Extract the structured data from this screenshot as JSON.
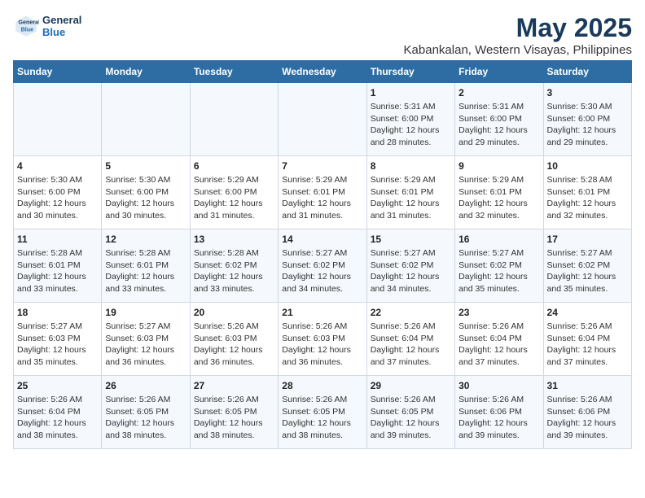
{
  "logo": {
    "line1": "General",
    "line2": "Blue"
  },
  "title": "May 2025",
  "subtitle": "Kabankalan, Western Visayas, Philippines",
  "headers": [
    "Sunday",
    "Monday",
    "Tuesday",
    "Wednesday",
    "Thursday",
    "Friday",
    "Saturday"
  ],
  "weeks": [
    [
      {
        "day": "",
        "info": ""
      },
      {
        "day": "",
        "info": ""
      },
      {
        "day": "",
        "info": ""
      },
      {
        "day": "",
        "info": ""
      },
      {
        "day": "1",
        "info": "Sunrise: 5:31 AM\nSunset: 6:00 PM\nDaylight: 12 hours\nand 28 minutes."
      },
      {
        "day": "2",
        "info": "Sunrise: 5:31 AM\nSunset: 6:00 PM\nDaylight: 12 hours\nand 29 minutes."
      },
      {
        "day": "3",
        "info": "Sunrise: 5:30 AM\nSunset: 6:00 PM\nDaylight: 12 hours\nand 29 minutes."
      }
    ],
    [
      {
        "day": "4",
        "info": "Sunrise: 5:30 AM\nSunset: 6:00 PM\nDaylight: 12 hours\nand 30 minutes."
      },
      {
        "day": "5",
        "info": "Sunrise: 5:30 AM\nSunset: 6:00 PM\nDaylight: 12 hours\nand 30 minutes."
      },
      {
        "day": "6",
        "info": "Sunrise: 5:29 AM\nSunset: 6:00 PM\nDaylight: 12 hours\nand 31 minutes."
      },
      {
        "day": "7",
        "info": "Sunrise: 5:29 AM\nSunset: 6:01 PM\nDaylight: 12 hours\nand 31 minutes."
      },
      {
        "day": "8",
        "info": "Sunrise: 5:29 AM\nSunset: 6:01 PM\nDaylight: 12 hours\nand 31 minutes."
      },
      {
        "day": "9",
        "info": "Sunrise: 5:29 AM\nSunset: 6:01 PM\nDaylight: 12 hours\nand 32 minutes."
      },
      {
        "day": "10",
        "info": "Sunrise: 5:28 AM\nSunset: 6:01 PM\nDaylight: 12 hours\nand 32 minutes."
      }
    ],
    [
      {
        "day": "11",
        "info": "Sunrise: 5:28 AM\nSunset: 6:01 PM\nDaylight: 12 hours\nand 33 minutes."
      },
      {
        "day": "12",
        "info": "Sunrise: 5:28 AM\nSunset: 6:01 PM\nDaylight: 12 hours\nand 33 minutes."
      },
      {
        "day": "13",
        "info": "Sunrise: 5:28 AM\nSunset: 6:02 PM\nDaylight: 12 hours\nand 33 minutes."
      },
      {
        "day": "14",
        "info": "Sunrise: 5:27 AM\nSunset: 6:02 PM\nDaylight: 12 hours\nand 34 minutes."
      },
      {
        "day": "15",
        "info": "Sunrise: 5:27 AM\nSunset: 6:02 PM\nDaylight: 12 hours\nand 34 minutes."
      },
      {
        "day": "16",
        "info": "Sunrise: 5:27 AM\nSunset: 6:02 PM\nDaylight: 12 hours\nand 35 minutes."
      },
      {
        "day": "17",
        "info": "Sunrise: 5:27 AM\nSunset: 6:02 PM\nDaylight: 12 hours\nand 35 minutes."
      }
    ],
    [
      {
        "day": "18",
        "info": "Sunrise: 5:27 AM\nSunset: 6:03 PM\nDaylight: 12 hours\nand 35 minutes."
      },
      {
        "day": "19",
        "info": "Sunrise: 5:27 AM\nSunset: 6:03 PM\nDaylight: 12 hours\nand 36 minutes."
      },
      {
        "day": "20",
        "info": "Sunrise: 5:26 AM\nSunset: 6:03 PM\nDaylight: 12 hours\nand 36 minutes."
      },
      {
        "day": "21",
        "info": "Sunrise: 5:26 AM\nSunset: 6:03 PM\nDaylight: 12 hours\nand 36 minutes."
      },
      {
        "day": "22",
        "info": "Sunrise: 5:26 AM\nSunset: 6:04 PM\nDaylight: 12 hours\nand 37 minutes."
      },
      {
        "day": "23",
        "info": "Sunrise: 5:26 AM\nSunset: 6:04 PM\nDaylight: 12 hours\nand 37 minutes."
      },
      {
        "day": "24",
        "info": "Sunrise: 5:26 AM\nSunset: 6:04 PM\nDaylight: 12 hours\nand 37 minutes."
      }
    ],
    [
      {
        "day": "25",
        "info": "Sunrise: 5:26 AM\nSunset: 6:04 PM\nDaylight: 12 hours\nand 38 minutes."
      },
      {
        "day": "26",
        "info": "Sunrise: 5:26 AM\nSunset: 6:05 PM\nDaylight: 12 hours\nand 38 minutes."
      },
      {
        "day": "27",
        "info": "Sunrise: 5:26 AM\nSunset: 6:05 PM\nDaylight: 12 hours\nand 38 minutes."
      },
      {
        "day": "28",
        "info": "Sunrise: 5:26 AM\nSunset: 6:05 PM\nDaylight: 12 hours\nand 38 minutes."
      },
      {
        "day": "29",
        "info": "Sunrise: 5:26 AM\nSunset: 6:05 PM\nDaylight: 12 hours\nand 39 minutes."
      },
      {
        "day": "30",
        "info": "Sunrise: 5:26 AM\nSunset: 6:06 PM\nDaylight: 12 hours\nand 39 minutes."
      },
      {
        "day": "31",
        "info": "Sunrise: 5:26 AM\nSunset: 6:06 PM\nDaylight: 12 hours\nand 39 minutes."
      }
    ]
  ]
}
